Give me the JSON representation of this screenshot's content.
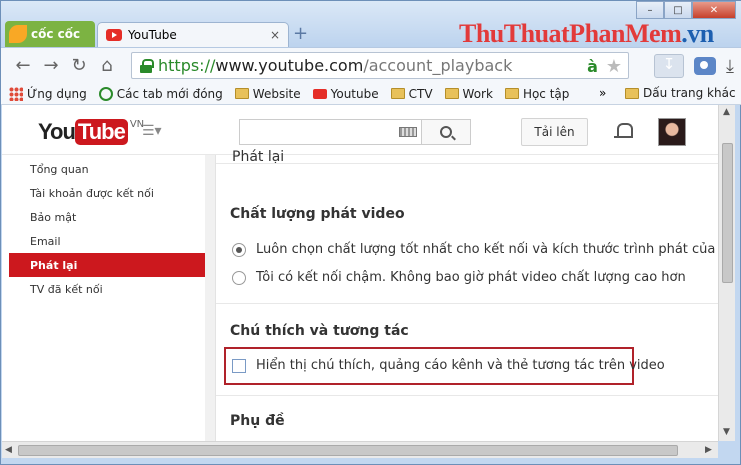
{
  "browser": {
    "brand": "cốc cốc",
    "tab_title": "YouTube",
    "tab_close": "×",
    "new_tab": "+",
    "watermark": "ThuThuatPhanMem",
    "watermark_suffix": ".vn",
    "window_controls": [
      "–",
      "□",
      "✕"
    ],
    "url": {
      "scheme": "https://",
      "host": "www.youtube.com",
      "path": "/account_playback"
    },
    "address_icon_a": "à",
    "bookmarks": [
      {
        "label": "Ứng dụng",
        "icon": "apps-icon"
      },
      {
        "label": "Các tab mới đóng",
        "icon": "clock-icon"
      },
      {
        "label": "Website",
        "icon": "folder-icon"
      },
      {
        "label": "Youtube",
        "icon": "youtube-icon"
      },
      {
        "label": "CTV",
        "icon": "folder-icon"
      },
      {
        "label": "Work",
        "icon": "folder-icon"
      },
      {
        "label": "Học tập",
        "icon": "folder-icon"
      }
    ],
    "bookmarks_more": "»",
    "bookmarks_other": "Dấu trang khác"
  },
  "youtube": {
    "logo_you": "You",
    "logo_tube": "Tube",
    "logo_country": "VN",
    "upload_label": "Tải lên",
    "sidebar": [
      {
        "label": "Tổng quan",
        "active": false
      },
      {
        "label": "Tài khoản được kết nối",
        "active": false
      },
      {
        "label": "Bảo mật",
        "active": false
      },
      {
        "label": "Email",
        "active": false
      },
      {
        "label": "Phát lại",
        "active": true
      },
      {
        "label": "TV đã kết nối",
        "active": false
      }
    ],
    "content": {
      "partial_title": "Phát lại",
      "quality_title": "Chất lượng phát video",
      "quality_options": [
        {
          "label": "Luôn chọn chất lượng tốt nhất cho kết nối và kích thước trình phát của tôi",
          "checked": true
        },
        {
          "label": "Tôi có kết nối chậm. Không bao giờ phát video chất lượng cao hơn",
          "checked": false
        }
      ],
      "annotations_title": "Chú thích và tương tác",
      "annotations_checkbox": "Hiển thị chú thích, quảng cáo kênh và thẻ tương tác trên video",
      "annotations_checked": false,
      "subtitles_title": "Phụ đề"
    }
  },
  "colors": {
    "accent_red": "#cc181e",
    "highlight_box": "#b0222a"
  }
}
